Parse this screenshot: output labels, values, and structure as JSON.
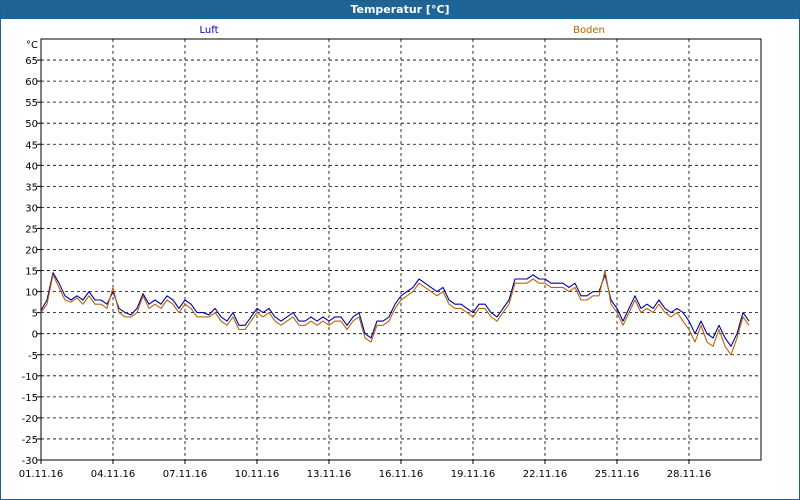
{
  "window": {
    "title": "Temperatur [°C]"
  },
  "chart_data": {
    "type": "line",
    "title": "Temperatur [°C]",
    "yunit": "°C",
    "ylim": [
      -30,
      70
    ],
    "yticks": [
      -30,
      -25,
      -20,
      -15,
      -10,
      -5,
      0,
      5,
      10,
      15,
      20,
      25,
      30,
      35,
      40,
      45,
      50,
      55,
      60,
      65
    ],
    "xlim": [
      "2016-11-01T00:00",
      "2016-12-01T00:00"
    ],
    "xticks": [
      {
        "x": "2016-11-01T00:00",
        "label": "01.11.16"
      },
      {
        "x": "2016-11-04T00:00",
        "label": "04.11.16"
      },
      {
        "x": "2016-11-07T00:00",
        "label": "07.11.16"
      },
      {
        "x": "2016-11-10T00:00",
        "label": "10.11.16"
      },
      {
        "x": "2016-11-13T00:00",
        "label": "13.11.16"
      },
      {
        "x": "2016-11-16T00:00",
        "label": "16.11.16"
      },
      {
        "x": "2016-11-19T00:00",
        "label": "19.11.16"
      },
      {
        "x": "2016-11-22T00:00",
        "label": "22.11.16"
      },
      {
        "x": "2016-11-25T00:00",
        "label": "25.11.16"
      },
      {
        "x": "2016-11-28T00:00",
        "label": "28.11.16"
      }
    ],
    "grid": true,
    "legend_position": "top",
    "series": [
      {
        "name": "Luft",
        "color": "#0000aa",
        "points": [
          [
            "2016-11-01T00:00",
            5.5
          ],
          [
            "2016-11-01T06:00",
            8
          ],
          [
            "2016-11-01T12:00",
            14.5
          ],
          [
            "2016-11-01T18:00",
            12
          ],
          [
            "2016-11-02T00:00",
            9
          ],
          [
            "2016-11-02T06:00",
            8
          ],
          [
            "2016-11-02T12:00",
            9
          ],
          [
            "2016-11-02T18:00",
            8
          ],
          [
            "2016-11-03T00:00",
            10
          ],
          [
            "2016-11-03T06:00",
            8
          ],
          [
            "2016-11-03T12:00",
            8
          ],
          [
            "2016-11-03T18:00",
            7
          ],
          [
            "2016-11-04T00:00",
            10
          ],
          [
            "2016-11-04T06:00",
            6
          ],
          [
            "2016-11-04T12:00",
            5
          ],
          [
            "2016-11-04T18:00",
            4.5
          ],
          [
            "2016-11-05T00:00",
            6
          ],
          [
            "2016-11-05T06:00",
            9.5
          ],
          [
            "2016-11-05T12:00",
            7
          ],
          [
            "2016-11-05T18:00",
            8
          ],
          [
            "2016-11-06T00:00",
            7
          ],
          [
            "2016-11-06T06:00",
            9
          ],
          [
            "2016-11-06T12:00",
            8
          ],
          [
            "2016-11-06T18:00",
            6
          ],
          [
            "2016-11-07T00:00",
            8
          ],
          [
            "2016-11-07T06:00",
            7
          ],
          [
            "2016-11-07T12:00",
            5
          ],
          [
            "2016-11-07T18:00",
            5
          ],
          [
            "2016-11-08T00:00",
            4.5
          ],
          [
            "2016-11-08T06:00",
            6
          ],
          [
            "2016-11-08T12:00",
            4
          ],
          [
            "2016-11-08T18:00",
            3
          ],
          [
            "2016-11-09T00:00",
            5
          ],
          [
            "2016-11-09T06:00",
            2
          ],
          [
            "2016-11-09T12:00",
            2
          ],
          [
            "2016-11-09T18:00",
            4
          ],
          [
            "2016-11-10T00:00",
            6
          ],
          [
            "2016-11-10T06:00",
            5
          ],
          [
            "2016-11-10T12:00",
            6
          ],
          [
            "2016-11-10T18:00",
            4
          ],
          [
            "2016-11-11T00:00",
            3
          ],
          [
            "2016-11-11T06:00",
            4
          ],
          [
            "2016-11-11T12:00",
            5
          ],
          [
            "2016-11-11T18:00",
            3
          ],
          [
            "2016-11-12T00:00",
            3
          ],
          [
            "2016-11-12T06:00",
            4
          ],
          [
            "2016-11-12T12:00",
            3
          ],
          [
            "2016-11-12T18:00",
            4
          ],
          [
            "2016-11-13T00:00",
            3
          ],
          [
            "2016-11-13T06:00",
            4
          ],
          [
            "2016-11-13T12:00",
            4
          ],
          [
            "2016-11-13T18:00",
            2
          ],
          [
            "2016-11-14T00:00",
            4
          ],
          [
            "2016-11-14T06:00",
            5
          ],
          [
            "2016-11-14T12:00",
            0
          ],
          [
            "2016-11-14T18:00",
            -1
          ],
          [
            "2016-11-15T00:00",
            3
          ],
          [
            "2016-11-15T06:00",
            3
          ],
          [
            "2016-11-15T12:00",
            4
          ],
          [
            "2016-11-15T18:00",
            7
          ],
          [
            "2016-11-16T00:00",
            9
          ],
          [
            "2016-11-16T06:00",
            10
          ],
          [
            "2016-11-16T12:00",
            11
          ],
          [
            "2016-11-16T18:00",
            13
          ],
          [
            "2016-11-17T00:00",
            12
          ],
          [
            "2016-11-17T06:00",
            11
          ],
          [
            "2016-11-17T12:00",
            10
          ],
          [
            "2016-11-17T18:00",
            11
          ],
          [
            "2016-11-18T00:00",
            8
          ],
          [
            "2016-11-18T06:00",
            7
          ],
          [
            "2016-11-18T12:00",
            7
          ],
          [
            "2016-11-18T18:00",
            6
          ],
          [
            "2016-11-19T00:00",
            5
          ],
          [
            "2016-11-19T06:00",
            7
          ],
          [
            "2016-11-19T12:00",
            7
          ],
          [
            "2016-11-19T18:00",
            5
          ],
          [
            "2016-11-20T00:00",
            4
          ],
          [
            "2016-11-20T06:00",
            6
          ],
          [
            "2016-11-20T12:00",
            8
          ],
          [
            "2016-11-20T18:00",
            13
          ],
          [
            "2016-11-21T00:00",
            13
          ],
          [
            "2016-11-21T06:00",
            13
          ],
          [
            "2016-11-21T12:00",
            14
          ],
          [
            "2016-11-21T18:00",
            13
          ],
          [
            "2016-11-22T00:00",
            13
          ],
          [
            "2016-11-22T06:00",
            12
          ],
          [
            "2016-11-22T12:00",
            12
          ],
          [
            "2016-11-22T18:00",
            12
          ],
          [
            "2016-11-23T00:00",
            11
          ],
          [
            "2016-11-23T06:00",
            12
          ],
          [
            "2016-11-23T12:00",
            9
          ],
          [
            "2016-11-23T18:00",
            9
          ],
          [
            "2016-11-24T00:00",
            10
          ],
          [
            "2016-11-24T06:00",
            10
          ],
          [
            "2016-11-24T12:00",
            14
          ],
          [
            "2016-11-24T18:00",
            8
          ],
          [
            "2016-11-25T00:00",
            6
          ],
          [
            "2016-11-25T06:00",
            3
          ],
          [
            "2016-11-25T12:00",
            6
          ],
          [
            "2016-11-25T18:00",
            9
          ],
          [
            "2016-11-26T00:00",
            6
          ],
          [
            "2016-11-26T06:00",
            7
          ],
          [
            "2016-11-26T12:00",
            6
          ],
          [
            "2016-11-26T18:00",
            8
          ],
          [
            "2016-11-27T00:00",
            6
          ],
          [
            "2016-11-27T06:00",
            5
          ],
          [
            "2016-11-27T12:00",
            6
          ],
          [
            "2016-11-27T18:00",
            5
          ],
          [
            "2016-11-28T00:00",
            3
          ],
          [
            "2016-11-28T06:00",
            0
          ],
          [
            "2016-11-28T12:00",
            3
          ],
          [
            "2016-11-28T18:00",
            0
          ],
          [
            "2016-11-29T00:00",
            -1
          ],
          [
            "2016-11-29T06:00",
            2
          ],
          [
            "2016-11-29T12:00",
            -1
          ],
          [
            "2016-11-29T18:00",
            -3
          ],
          [
            "2016-11-30T00:00",
            0
          ],
          [
            "2016-11-30T06:00",
            5
          ],
          [
            "2016-11-30T12:00",
            3
          ]
        ]
      },
      {
        "name": "Boden",
        "color": "#b86400",
        "points": [
          [
            "2016-11-01T00:00",
            5
          ],
          [
            "2016-11-01T06:00",
            7
          ],
          [
            "2016-11-01T12:00",
            14
          ],
          [
            "2016-11-01T18:00",
            11
          ],
          [
            "2016-11-02T00:00",
            8
          ],
          [
            "2016-11-02T06:00",
            7.5
          ],
          [
            "2016-11-02T12:00",
            8.5
          ],
          [
            "2016-11-02T18:00",
            7
          ],
          [
            "2016-11-03T00:00",
            9
          ],
          [
            "2016-11-03T06:00",
            7
          ],
          [
            "2016-11-03T12:00",
            7
          ],
          [
            "2016-11-03T18:00",
            6
          ],
          [
            "2016-11-04T00:00",
            11
          ],
          [
            "2016-11-04T06:00",
            5
          ],
          [
            "2016-11-04T12:00",
            4
          ],
          [
            "2016-11-04T18:00",
            4
          ],
          [
            "2016-11-05T00:00",
            5
          ],
          [
            "2016-11-05T06:00",
            9
          ],
          [
            "2016-11-05T12:00",
            6
          ],
          [
            "2016-11-05T18:00",
            7
          ],
          [
            "2016-11-06T00:00",
            6
          ],
          [
            "2016-11-06T06:00",
            8
          ],
          [
            "2016-11-06T12:00",
            7
          ],
          [
            "2016-11-06T18:00",
            5
          ],
          [
            "2016-11-07T00:00",
            7
          ],
          [
            "2016-11-07T06:00",
            6
          ],
          [
            "2016-11-07T12:00",
            4
          ],
          [
            "2016-11-07T18:00",
            4
          ],
          [
            "2016-11-08T00:00",
            4
          ],
          [
            "2016-11-08T06:00",
            5
          ],
          [
            "2016-11-08T12:00",
            3
          ],
          [
            "2016-11-08T18:00",
            2
          ],
          [
            "2016-11-09T00:00",
            4
          ],
          [
            "2016-11-09T06:00",
            1
          ],
          [
            "2016-11-09T12:00",
            1
          ],
          [
            "2016-11-09T18:00",
            3
          ],
          [
            "2016-11-10T00:00",
            5
          ],
          [
            "2016-11-10T06:00",
            4
          ],
          [
            "2016-11-10T12:00",
            5
          ],
          [
            "2016-11-10T18:00",
            3
          ],
          [
            "2016-11-11T00:00",
            2
          ],
          [
            "2016-11-11T06:00",
            3
          ],
          [
            "2016-11-11T12:00",
            4
          ],
          [
            "2016-11-11T18:00",
            2
          ],
          [
            "2016-11-12T00:00",
            2
          ],
          [
            "2016-11-12T06:00",
            3
          ],
          [
            "2016-11-12T12:00",
            2
          ],
          [
            "2016-11-12T18:00",
            3
          ],
          [
            "2016-11-13T00:00",
            2
          ],
          [
            "2016-11-13T06:00",
            3
          ],
          [
            "2016-11-13T12:00",
            3
          ],
          [
            "2016-11-13T18:00",
            1
          ],
          [
            "2016-11-14T00:00",
            3
          ],
          [
            "2016-11-14T06:00",
            4
          ],
          [
            "2016-11-14T12:00",
            -1
          ],
          [
            "2016-11-14T18:00",
            -2
          ],
          [
            "2016-11-15T00:00",
            2
          ],
          [
            "2016-11-15T06:00",
            2
          ],
          [
            "2016-11-15T12:00",
            3
          ],
          [
            "2016-11-15T18:00",
            6
          ],
          [
            "2016-11-16T00:00",
            8
          ],
          [
            "2016-11-16T06:00",
            9
          ],
          [
            "2016-11-16T12:00",
            10
          ],
          [
            "2016-11-16T18:00",
            12
          ],
          [
            "2016-11-17T00:00",
            11
          ],
          [
            "2016-11-17T06:00",
            10
          ],
          [
            "2016-11-17T12:00",
            9
          ],
          [
            "2016-11-17T18:00",
            10
          ],
          [
            "2016-11-18T00:00",
            7
          ],
          [
            "2016-11-18T06:00",
            6
          ],
          [
            "2016-11-18T12:00",
            6
          ],
          [
            "2016-11-18T18:00",
            5
          ],
          [
            "2016-11-19T00:00",
            4
          ],
          [
            "2016-11-19T06:00",
            6
          ],
          [
            "2016-11-19T12:00",
            6
          ],
          [
            "2016-11-19T18:00",
            4
          ],
          [
            "2016-11-20T00:00",
            3
          ],
          [
            "2016-11-20T06:00",
            5
          ],
          [
            "2016-11-20T12:00",
            7
          ],
          [
            "2016-11-20T18:00",
            12
          ],
          [
            "2016-11-21T00:00",
            12
          ],
          [
            "2016-11-21T06:00",
            12
          ],
          [
            "2016-11-21T12:00",
            13
          ],
          [
            "2016-11-21T18:00",
            12
          ],
          [
            "2016-11-22T00:00",
            12
          ],
          [
            "2016-11-22T06:00",
            11
          ],
          [
            "2016-11-22T12:00",
            11
          ],
          [
            "2016-11-22T18:00",
            11
          ],
          [
            "2016-11-23T00:00",
            10
          ],
          [
            "2016-11-23T06:00",
            11
          ],
          [
            "2016-11-23T12:00",
            8
          ],
          [
            "2016-11-23T18:00",
            8
          ],
          [
            "2016-11-24T00:00",
            9
          ],
          [
            "2016-11-24T06:00",
            9
          ],
          [
            "2016-11-24T12:00",
            15
          ],
          [
            "2016-11-24T18:00",
            7
          ],
          [
            "2016-11-25T00:00",
            5
          ],
          [
            "2016-11-25T06:00",
            2
          ],
          [
            "2016-11-25T12:00",
            5
          ],
          [
            "2016-11-25T18:00",
            8
          ],
          [
            "2016-11-26T00:00",
            5
          ],
          [
            "2016-11-26T06:00",
            6
          ],
          [
            "2016-11-26T12:00",
            5
          ],
          [
            "2016-11-26T18:00",
            7
          ],
          [
            "2016-11-27T00:00",
            5
          ],
          [
            "2016-11-27T06:00",
            4
          ],
          [
            "2016-11-27T12:00",
            5
          ],
          [
            "2016-11-27T18:00",
            3
          ],
          [
            "2016-11-28T00:00",
            1
          ],
          [
            "2016-11-28T06:00",
            -2
          ],
          [
            "2016-11-28T12:00",
            2
          ],
          [
            "2016-11-28T18:00",
            -2
          ],
          [
            "2016-11-29T00:00",
            -3
          ],
          [
            "2016-11-29T06:00",
            1
          ],
          [
            "2016-11-29T12:00",
            -3
          ],
          [
            "2016-11-29T18:00",
            -5
          ],
          [
            "2016-11-30T00:00",
            -1
          ],
          [
            "2016-11-30T06:00",
            4
          ],
          [
            "2016-11-30T12:00",
            2
          ]
        ]
      }
    ]
  }
}
